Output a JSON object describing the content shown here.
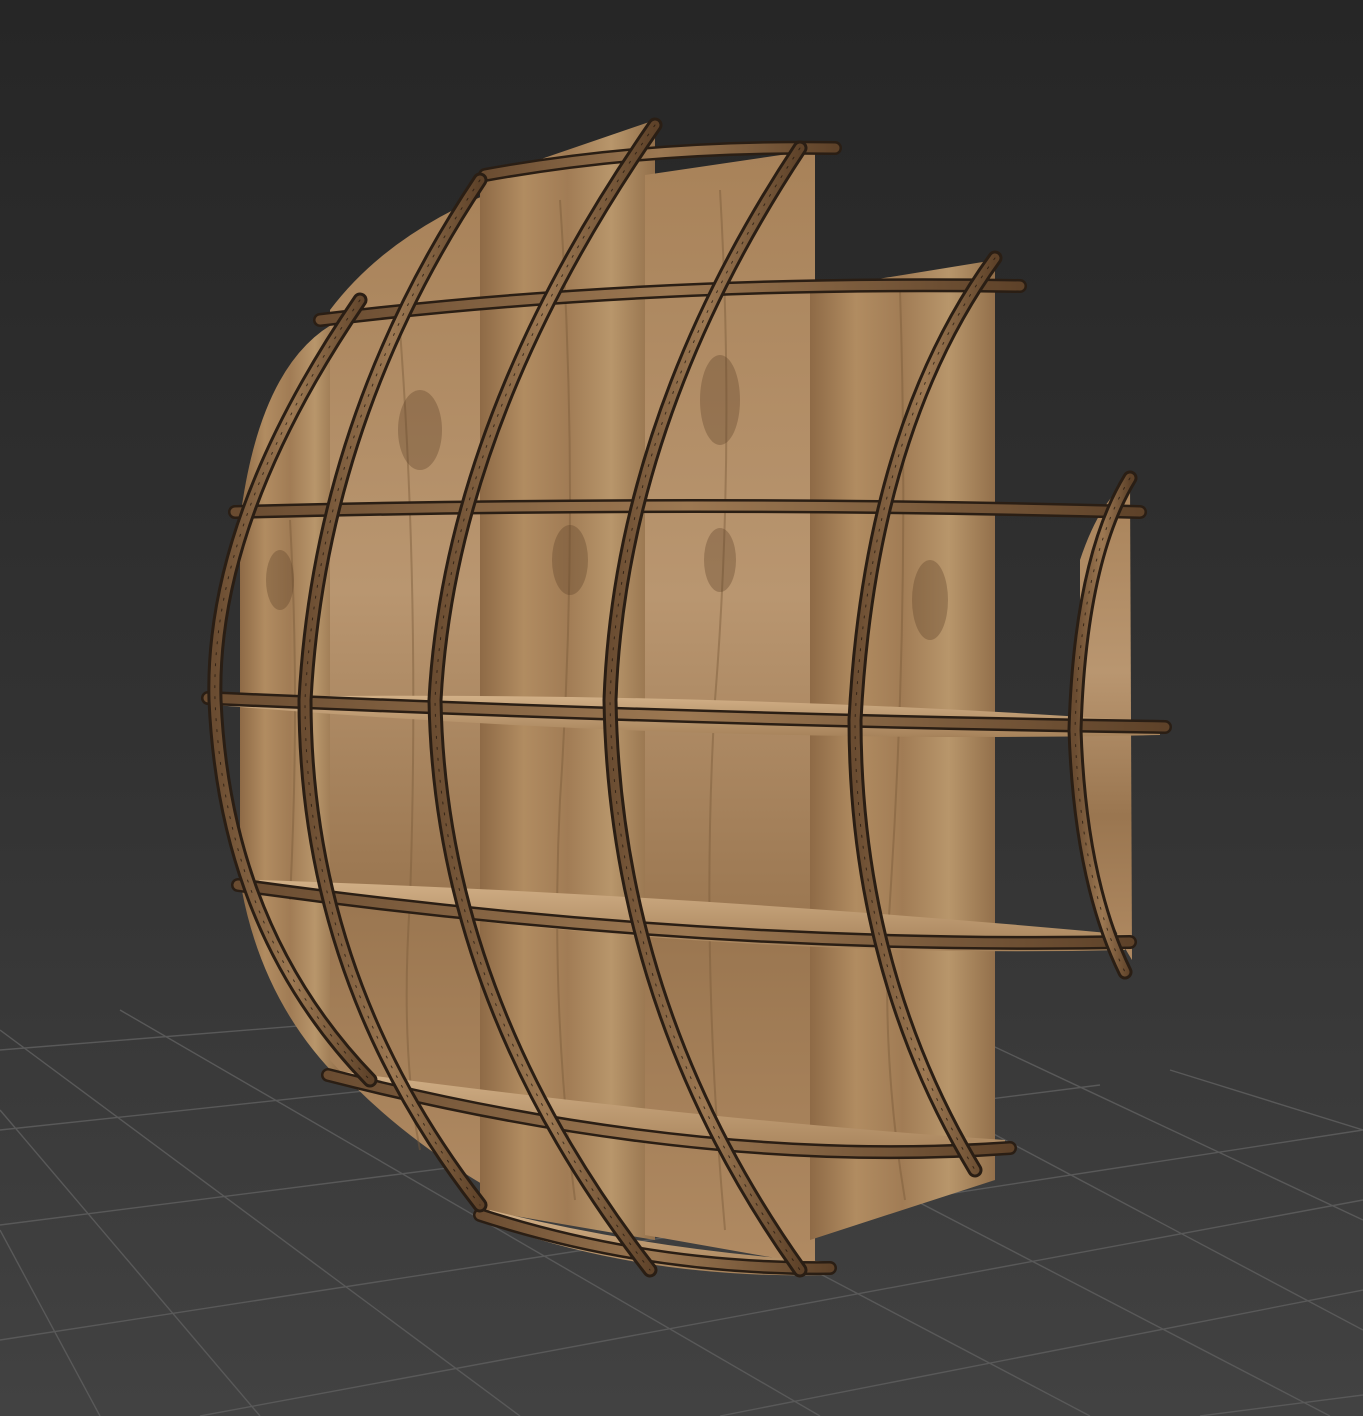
{
  "viewport": {
    "object": "spherical-wooden-shelf",
    "view": "perspective-3d",
    "colors": {
      "background_top": "#2b2b2b",
      "background_bottom": "#3e3e3e",
      "grid_line": "#595959",
      "wood_light": "#b58f62",
      "wood_mid": "#9c7650",
      "wood_dark": "#6e5034",
      "edge_wire": "#2a1e14",
      "shelf_top": "#c8a47a"
    }
  }
}
